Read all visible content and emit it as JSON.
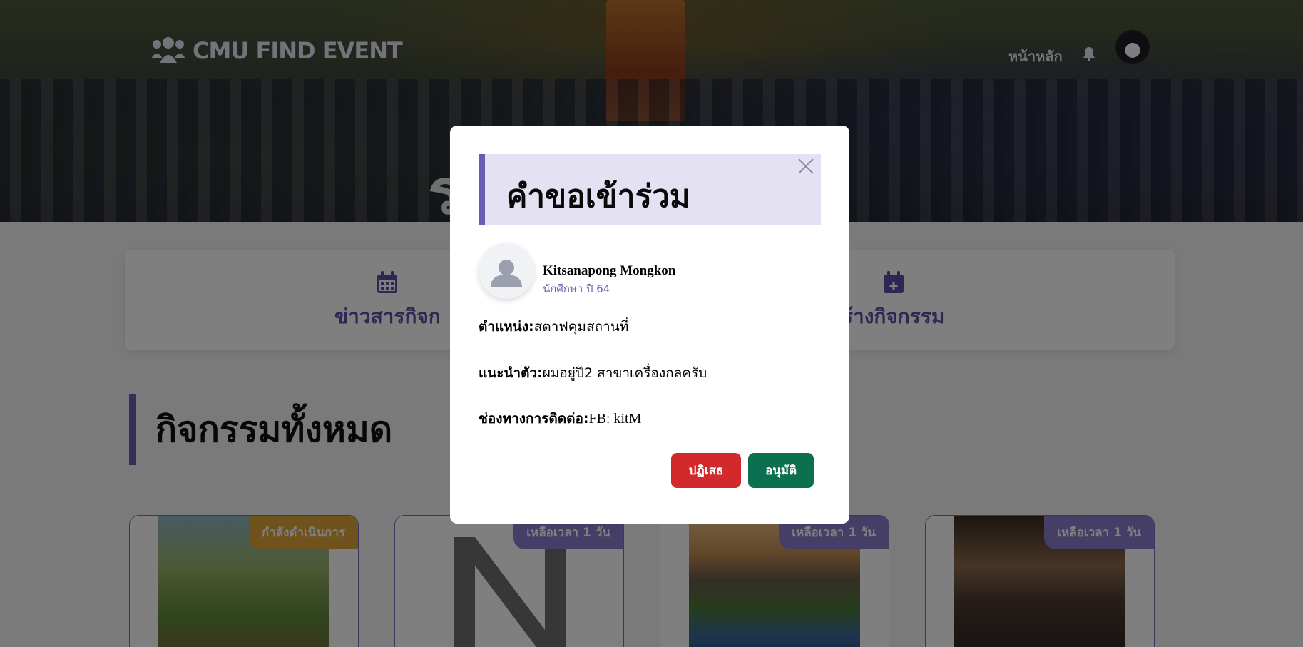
{
  "navbar": {
    "brand": "CMU FIND EVENT",
    "home_link": "หน้าหลัก"
  },
  "hero": {
    "title_visible": "ร                   รม"
  },
  "menu": {
    "items": [
      {
        "label": "ข่าวสารกิจก",
        "icon": "calendar-icon"
      },
      {
        "label": "ร้างกิจกรรม",
        "icon": "calendar-plus-icon"
      }
    ]
  },
  "section": {
    "title": "กิจกรรมทั้งหมด"
  },
  "events": [
    {
      "badge": "กำลังดำเนินการ",
      "badge_color": "#e0a43a"
    },
    {
      "badge": "เหลือเวลา 1 วัน",
      "badge_color": "#8a7fd0"
    },
    {
      "badge": "เหลือเวลา 1 วัน",
      "badge_color": "#8a7fd0"
    },
    {
      "badge": "เหลือเวลา 1 วัน",
      "badge_color": "#8a7fd0"
    }
  ],
  "modal": {
    "title": "คำขอเข้าร่วม",
    "applicant": {
      "name": "Kitsanapong Mongkon",
      "role": "นักศึกษา ปี 64"
    },
    "fields": [
      {
        "label": "ตำแหน่ง:",
        "value": "สตาฟคุมสถานที่"
      },
      {
        "label": "แนะนำตัว:",
        "value": "ผมอยู่ปี2 สาขาเครื่องกลครับ"
      },
      {
        "label": "ช่องทางการติดต่อ:",
        "value": "FB: kitM"
      }
    ],
    "reject_label": "ปฏิเสธ",
    "approve_label": "อนุมัติ"
  },
  "colors": {
    "accent": "#6a5cb0",
    "reject": "#d22a2a",
    "approve": "#0c7050"
  }
}
